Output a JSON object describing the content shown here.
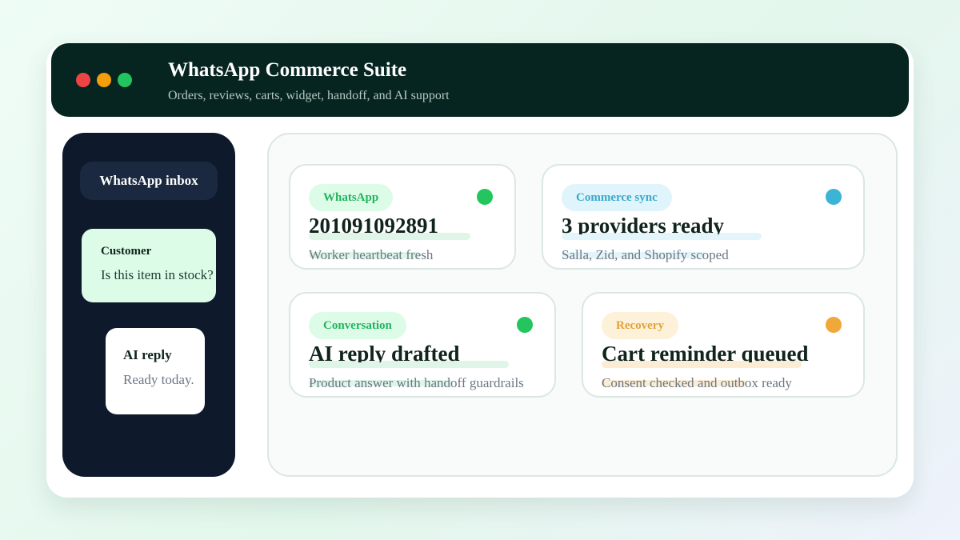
{
  "window": {
    "controls": [
      {
        "name": "close",
        "color": "#ef4444"
      },
      {
        "name": "minimize",
        "color": "#f59e0b"
      },
      {
        "name": "maximize",
        "color": "#22c55e"
      }
    ],
    "title": "WhatsApp Commerce Suite",
    "subtitle": "Orders, reviews, carts, widget, handoff, and AI support"
  },
  "sidebar": {
    "inbox_label": "WhatsApp inbox",
    "customer_message": {
      "sender": "Customer",
      "text": "Is this item in stock?"
    },
    "ai_message": {
      "sender": "AI reply",
      "text": "Ready today."
    }
  },
  "cards": [
    {
      "badge": "WhatsApp",
      "headline": "201091092891",
      "description": "Worker heartbeat fresh",
      "accent": "#22c55e",
      "badge_bg": "#dcfce7",
      "badge_text": "#22b35e",
      "underline": "#dff5e8"
    },
    {
      "badge": "Commerce sync",
      "headline": "3 providers ready",
      "description": "Salla, Zid, and Shopify scoped",
      "accent": "#3bb4d6",
      "badge_bg": "#e0f4fb",
      "badge_text": "#3aa9c9",
      "underline": "#e3f4fa"
    },
    {
      "badge": "Conversation",
      "headline": "AI reply drafted",
      "description": "Product answer with handoff guardrails",
      "accent": "#22c55e",
      "badge_bg": "#dcfce7",
      "badge_text": "#22b35e",
      "underline": "#dff5e8"
    },
    {
      "badge": "Recovery",
      "headline": "Cart reminder queued",
      "description": "Consent checked and outbox ready",
      "accent": "#f0a83a",
      "badge_bg": "#fdf1d9",
      "badge_text": "#e0a23c",
      "underline": "#fcecd4"
    }
  ]
}
